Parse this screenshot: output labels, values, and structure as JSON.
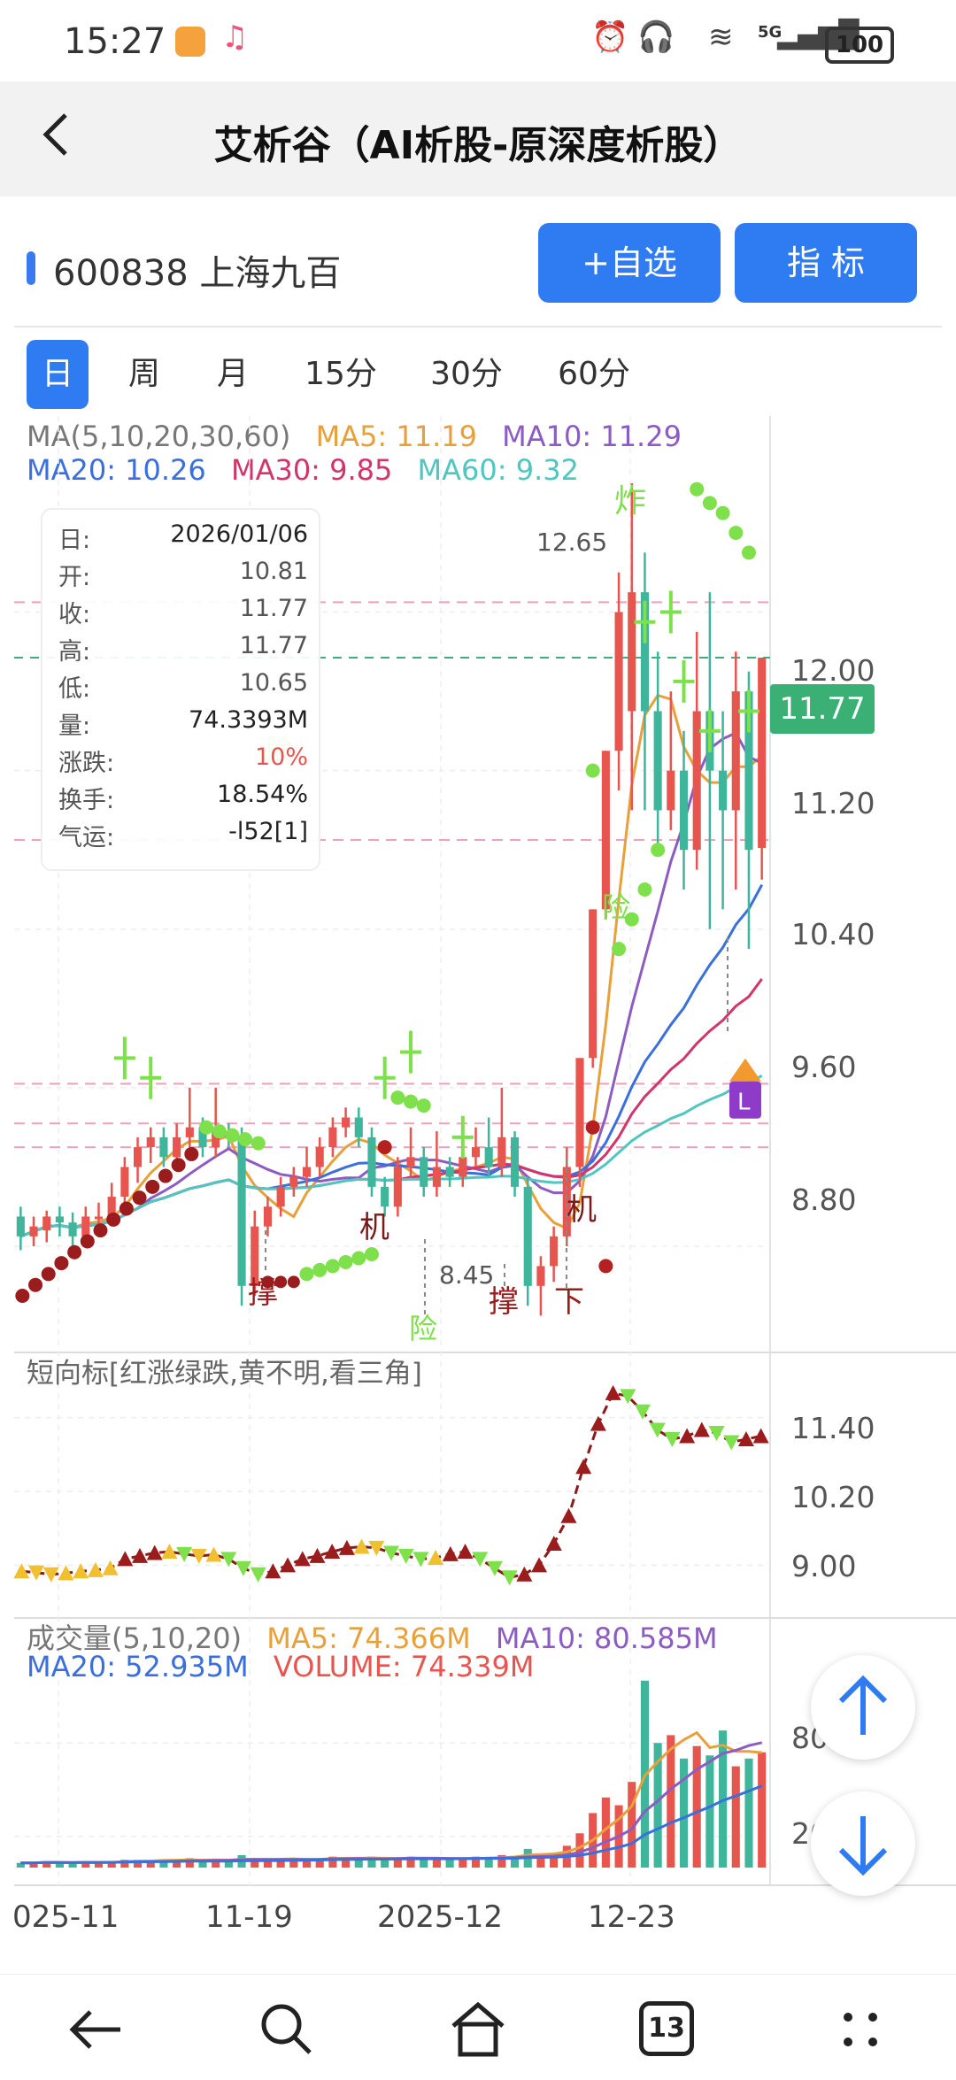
{
  "status": {
    "time": "15:27",
    "battery": "100",
    "network": "5G"
  },
  "header": {
    "title": "艾析谷（AI析股-原深度析股）"
  },
  "stock": {
    "code_name": "600838 上海九百",
    "add_watch_label": "+自选",
    "indicator_label": "指 标"
  },
  "tabs": [
    {
      "label": "日"
    },
    {
      "label": "周"
    },
    {
      "label": "月"
    },
    {
      "label": "15分"
    },
    {
      "label": "30分"
    },
    {
      "label": "60分"
    }
  ],
  "ma_legend": {
    "main": "MA(5,10,20,30,60)",
    "ma5": "MA5: 11.19",
    "ma10": "MA10: 11.29",
    "ma20": "MA20: 10.26",
    "ma30": "MA30: 9.85",
    "ma60": "MA60: 9.32"
  },
  "info": {
    "date_label": "日:",
    "date": "2026/01/06",
    "open_label": "开:",
    "open": "10.81",
    "close_label": "收:",
    "close": "11.77",
    "high_label": "高:",
    "high": "11.77",
    "low_label": "低:",
    "low": "10.65",
    "vol_label": "量:",
    "vol": "74.3393M",
    "chg_label": "涨跌:",
    "chg": "10%",
    "turnover_label": "换手:",
    "turnover": "18.54%",
    "luck_label": "气运:",
    "luck": "-l52[1]"
  },
  "price_tag": "11.77",
  "price_axis": [
    "12.00",
    "11.20",
    "10.40",
    "9.60",
    "8.80"
  ],
  "annotations": {
    "high": "12.65",
    "low": "8.45",
    "zha": "炸",
    "xian": "险",
    "ji": "机",
    "cheng": "撑",
    "xia": "下",
    "L": "L"
  },
  "short_panel": {
    "title": "短向标[红涨绿跌,黄不明,看三角]",
    "axis": [
      "11.40",
      "10.20",
      "9.00"
    ]
  },
  "volume_panel": {
    "title": "成交量(5,10,20)",
    "ma5": "MA5: 74.366M",
    "ma10": "MA10: 80.585M",
    "ma20": "MA20: 52.935M",
    "volume": "VOLUME: 74.339M",
    "axis": [
      "80",
      "20"
    ]
  },
  "xaxis": [
    "025-11",
    "11-19",
    "2025-12",
    "12-23"
  ],
  "colors": {
    "up": "#e8554e",
    "down": "#3fb59b",
    "accent": "#2f7bf2",
    "ma5": "#e8a03a",
    "ma10": "#8c5cc2",
    "ma20": "#3a6fdc",
    "ma30": "#d2356a",
    "ma60": "#4fc7c0"
  },
  "nav": {
    "recent_count": "13"
  },
  "chart_data": {
    "type": "candlestick",
    "ylim": [
      8.3,
      12.9
    ],
    "candles": [
      {
        "o": 8.95,
        "c": 8.85,
        "h": 9.0,
        "l": 8.78
      },
      {
        "o": 8.85,
        "c": 8.9,
        "h": 8.95,
        "l": 8.8
      },
      {
        "o": 8.88,
        "c": 8.95,
        "h": 8.98,
        "l": 8.82
      },
      {
        "o": 8.95,
        "c": 8.92,
        "h": 9.0,
        "l": 8.85
      },
      {
        "o": 8.92,
        "c": 8.85,
        "h": 8.97,
        "l": 8.8
      },
      {
        "o": 8.85,
        "c": 8.95,
        "h": 9.0,
        "l": 8.8
      },
      {
        "o": 8.95,
        "c": 8.95,
        "h": 9.02,
        "l": 8.88
      },
      {
        "o": 8.95,
        "c": 9.05,
        "h": 9.12,
        "l": 8.9
      },
      {
        "o": 9.05,
        "c": 9.2,
        "h": 9.25,
        "l": 9.0
      },
      {
        "o": 9.2,
        "c": 9.3,
        "h": 9.35,
        "l": 9.12
      },
      {
        "o": 9.3,
        "c": 9.35,
        "h": 9.4,
        "l": 9.22
      },
      {
        "o": 9.35,
        "c": 9.25,
        "h": 9.4,
        "l": 9.2
      },
      {
        "o": 9.25,
        "c": 9.35,
        "h": 9.42,
        "l": 9.2
      },
      {
        "o": 9.35,
        "c": 9.4,
        "h": 9.6,
        "l": 9.3
      },
      {
        "o": 9.4,
        "c": 9.3,
        "h": 9.45,
        "l": 9.25
      },
      {
        "o": 9.3,
        "c": 9.38,
        "h": 9.6,
        "l": 9.25
      },
      {
        "o": 9.38,
        "c": 9.35,
        "h": 9.42,
        "l": 9.3
      },
      {
        "o": 9.35,
        "c": 8.6,
        "h": 9.4,
        "l": 8.5
      },
      {
        "o": 8.6,
        "c": 8.9,
        "h": 8.98,
        "l": 8.55
      },
      {
        "o": 8.9,
        "c": 9.0,
        "h": 9.05,
        "l": 8.85
      },
      {
        "o": 9.0,
        "c": 9.1,
        "h": 9.15,
        "l": 8.95
      },
      {
        "o": 9.1,
        "c": 9.15,
        "h": 9.2,
        "l": 9.05
      },
      {
        "o": 9.15,
        "c": 9.2,
        "h": 9.3,
        "l": 9.1
      },
      {
        "o": 9.2,
        "c": 9.3,
        "h": 9.35,
        "l": 9.15
      },
      {
        "o": 9.3,
        "c": 9.4,
        "h": 9.45,
        "l": 9.25
      },
      {
        "o": 9.4,
        "c": 9.45,
        "h": 9.5,
        "l": 9.35
      },
      {
        "o": 9.45,
        "c": 9.35,
        "h": 9.5,
        "l": 9.3
      },
      {
        "o": 9.35,
        "c": 9.1,
        "h": 9.4,
        "l": 9.05
      },
      {
        "o": 9.1,
        "c": 9.0,
        "h": 9.15,
        "l": 8.95
      },
      {
        "o": 9.0,
        "c": 9.2,
        "h": 9.25,
        "l": 8.95
      },
      {
        "o": 9.2,
        "c": 9.25,
        "h": 9.4,
        "l": 9.15
      },
      {
        "o": 9.25,
        "c": 9.1,
        "h": 9.3,
        "l": 9.05
      },
      {
        "o": 9.1,
        "c": 9.2,
        "h": 9.38,
        "l": 9.05
      },
      {
        "o": 9.2,
        "c": 9.15,
        "h": 9.25,
        "l": 9.1
      },
      {
        "o": 9.15,
        "c": 9.25,
        "h": 9.35,
        "l": 9.1
      },
      {
        "o": 9.25,
        "c": 9.3,
        "h": 9.4,
        "l": 9.2
      },
      {
        "o": 9.3,
        "c": 9.2,
        "h": 9.45,
        "l": 9.15
      },
      {
        "o": 9.2,
        "c": 9.35,
        "h": 9.6,
        "l": 9.15
      },
      {
        "o": 9.35,
        "c": 9.1,
        "h": 9.38,
        "l": 9.05
      },
      {
        "o": 9.1,
        "c": 8.6,
        "h": 9.15,
        "l": 8.5
      },
      {
        "o": 8.6,
        "c": 8.7,
        "h": 8.75,
        "l": 8.45
      },
      {
        "o": 8.7,
        "c": 8.85,
        "h": 8.9,
        "l": 8.62
      },
      {
        "o": 8.85,
        "c": 9.2,
        "h": 9.3,
        "l": 8.8
      },
      {
        "o": 9.2,
        "c": 9.75,
        "h": 9.75,
        "l": 9.1
      },
      {
        "o": 9.75,
        "c": 10.5,
        "h": 10.5,
        "l": 9.7
      },
      {
        "o": 10.5,
        "c": 11.3,
        "h": 11.3,
        "l": 10.45
      },
      {
        "o": 11.3,
        "c": 12.0,
        "h": 12.2,
        "l": 11.1
      },
      {
        "o": 11.5,
        "c": 12.1,
        "h": 12.65,
        "l": 11.0
      },
      {
        "o": 12.1,
        "c": 11.5,
        "h": 12.3,
        "l": 11.0
      },
      {
        "o": 11.5,
        "c": 11.0,
        "h": 11.8,
        "l": 10.8
      },
      {
        "o": 11.0,
        "c": 11.2,
        "h": 11.6,
        "l": 10.9
      },
      {
        "o": 11.2,
        "c": 10.8,
        "h": 11.4,
        "l": 10.6
      },
      {
        "o": 10.8,
        "c": 11.5,
        "h": 11.9,
        "l": 10.7
      },
      {
        "o": 11.5,
        "c": 11.2,
        "h": 12.1,
        "l": 10.4
      },
      {
        "o": 11.2,
        "c": 11.0,
        "h": 11.5,
        "l": 10.5
      },
      {
        "o": 11.0,
        "c": 11.6,
        "h": 11.8,
        "l": 10.6
      },
      {
        "o": 11.6,
        "c": 10.8,
        "h": 11.7,
        "l": 10.3
      },
      {
        "o": 10.81,
        "c": 11.77,
        "h": 11.77,
        "l": 10.65
      }
    ],
    "volumes": [
      3,
      3,
      4,
      3,
      3,
      4,
      3,
      4,
      5,
      5,
      4,
      5,
      5,
      6,
      4,
      5,
      4,
      8,
      6,
      4,
      5,
      5,
      6,
      6,
      7,
      6,
      5,
      7,
      5,
      6,
      7,
      5,
      6,
      5,
      6,
      7,
      6,
      8,
      7,
      12,
      9,
      8,
      14,
      22,
      35,
      45,
      40,
      55,
      120,
      80,
      85,
      70,
      78,
      72,
      88,
      65,
      70,
      74
    ]
  }
}
